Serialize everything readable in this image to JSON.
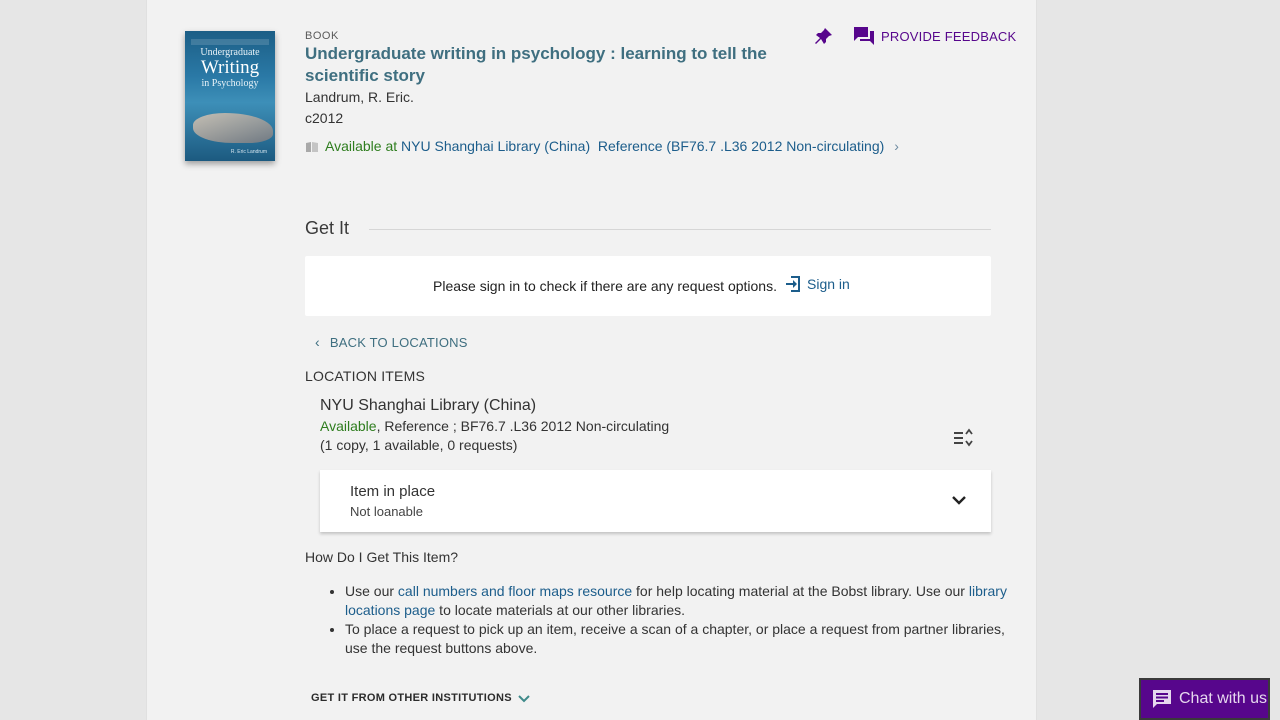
{
  "record": {
    "cover": {
      "title_small": "Undergraduate",
      "title_big": "Writing",
      "title_rest": "in Psychology",
      "author_small": "R. Eric Landrum"
    },
    "type": "BOOK",
    "title": "Undergraduate writing in psychology : learning to tell the scientific story",
    "author": "Landrum, R. Eric.",
    "date": "c2012",
    "availability": {
      "status": "Available at",
      "library": "NYU Shanghai Library (China)",
      "location": "Reference (BF76.7 .L36 2012 Non-circulating)"
    }
  },
  "actions": {
    "pin_icon": "pin-icon",
    "feedback_label": "PROVIDE FEEDBACK"
  },
  "getit": {
    "heading": "Get It",
    "signin_prompt": "Please sign in to check if there are any request options.",
    "signin_label": "Sign in",
    "back_label": "BACK TO LOCATIONS",
    "location_items_label": "LOCATION ITEMS",
    "library_name": "NYU Shanghai Library (China)",
    "status": "Available",
    "location_detail": ", Reference ; BF76.7 .L36 2012 Non-circulating",
    "copies": "(1 copy, 1 available, 0 requests)",
    "item": {
      "title": "Item in place",
      "policy": "Not loanable"
    },
    "how_heading": "How Do I Get This Item?",
    "help": {
      "b1_pre": "Use our ",
      "b1_link1": "call numbers and floor maps resource",
      "b1_mid": " for help locating material at the Bobst library. Use our ",
      "b1_link2": "library locations page",
      "b1_post": " to locate materials at our other libraries.",
      "b2": "To place a request to pick up an item, receive a scan of a chapter, or place a request from partner libraries, use the request buttons above."
    },
    "other_institutions": "GET IT FROM OTHER INSTITUTIONS"
  },
  "chat": {
    "label": "Chat with us"
  },
  "colors": {
    "link": "#1c5d8b",
    "available": "#2e7d1e",
    "brand_purple": "#57068c",
    "title": "#3f6f80"
  }
}
